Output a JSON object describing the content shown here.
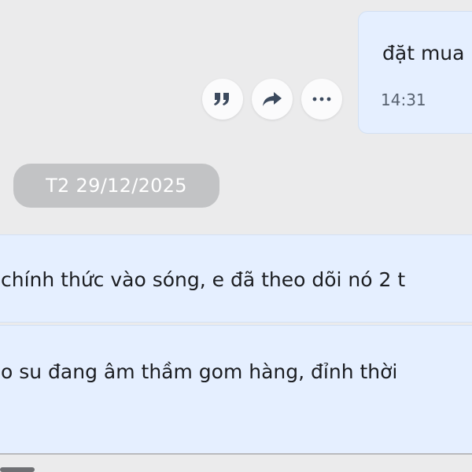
{
  "sent_message": {
    "text": "đặt mua",
    "time": "14:31"
  },
  "message_actions": [
    {
      "name": "quote",
      "icon": "quote-icon"
    },
    {
      "name": "forward",
      "icon": "share-arrow-icon"
    },
    {
      "name": "more",
      "icon": "more-dots-icon"
    }
  ],
  "date_divider": {
    "label": "T2 29/12/2025"
  },
  "received_messages": [
    {
      "text": "chính thức vào sóng, e đã theo dõi nó 2 t"
    },
    {
      "text": "o su đang âm thầm gom hàng, đỉnh thời"
    }
  ],
  "colors": {
    "background": "#ebebec",
    "bubble": "#e5efff",
    "date_pill": "#c2c3c5",
    "text": "#1b1d21"
  }
}
